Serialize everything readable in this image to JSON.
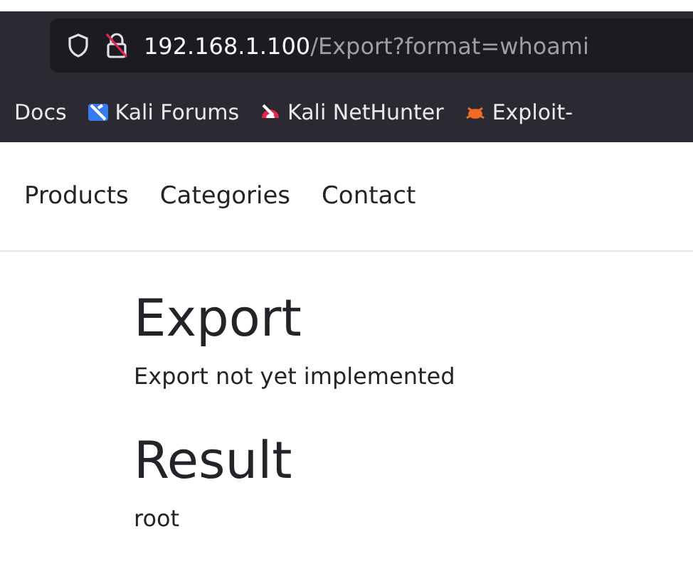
{
  "address_bar": {
    "host": "192.168.1.100",
    "path": "/Export?format=whoami"
  },
  "bookmarks": [
    {
      "label": "Docs",
      "kind": "none"
    },
    {
      "label": "Kali Forums",
      "kind": "forums"
    },
    {
      "label": "Kali NetHunter",
      "kind": "nethunter"
    },
    {
      "label": "Exploit-",
      "kind": "exploit"
    }
  ],
  "nav": [
    "Products",
    "Categories",
    "Contact"
  ],
  "sections": [
    {
      "heading": "Export",
      "text": "Export not yet implemented"
    },
    {
      "heading": "Result",
      "text": "root"
    }
  ]
}
